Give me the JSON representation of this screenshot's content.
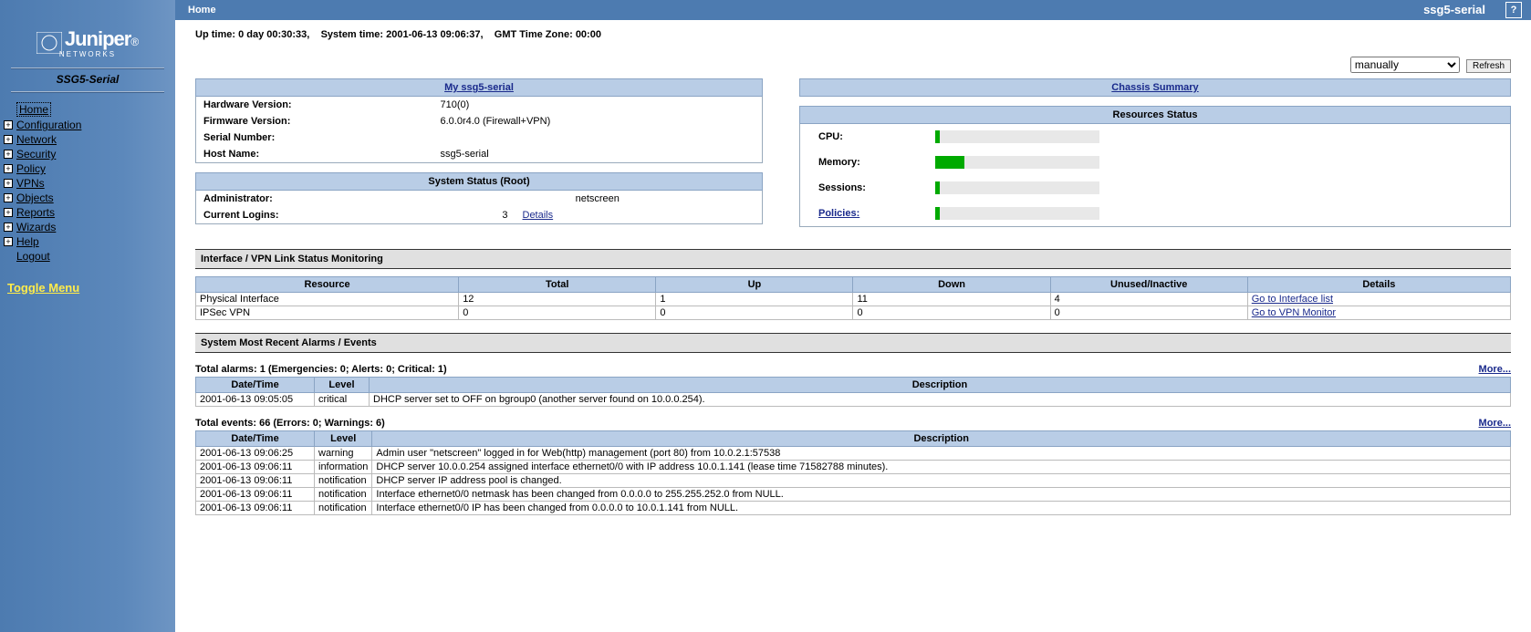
{
  "topbar": {
    "title": "Home",
    "device": "ssg5-serial",
    "help": "?"
  },
  "sidebar": {
    "device_model": "SSG5-Serial",
    "brand_top": "Juniper",
    "brand_sub": "NETWORKS",
    "items": [
      {
        "label": "Home",
        "expandable": false,
        "current": true
      },
      {
        "label": "Configuration",
        "expandable": true
      },
      {
        "label": "Network",
        "expandable": true
      },
      {
        "label": "Security",
        "expandable": true
      },
      {
        "label": "Policy",
        "expandable": true
      },
      {
        "label": "VPNs",
        "expandable": true
      },
      {
        "label": "Objects",
        "expandable": true
      },
      {
        "label": "Reports",
        "expandable": true
      },
      {
        "label": "Wizards",
        "expandable": true
      },
      {
        "label": "Help",
        "expandable": true
      },
      {
        "label": "Logout",
        "expandable": false
      }
    ],
    "toggle": "Toggle Menu"
  },
  "status_line": {
    "uptime_label": "Up time:",
    "uptime_value": "0 day 00:30:33,",
    "systime_label": "System time:",
    "systime_value": "2001-06-13 09:06:37,",
    "tz_label": "GMT Time Zone:",
    "tz_value": "00:00"
  },
  "refresh": {
    "mode": "manually",
    "button": "Refresh"
  },
  "device_panel": {
    "title": "My ssg5-serial",
    "rows": [
      {
        "label": "Hardware Version:",
        "value": "710(0)"
      },
      {
        "label": "Firmware Version:",
        "value": "6.0.0r4.0 (Firewall+VPN)"
      },
      {
        "label": "Serial Number:",
        "value": ""
      },
      {
        "label": "Host Name:",
        "value": "ssg5-serial"
      }
    ]
  },
  "system_status": {
    "title": "System Status  (Root)",
    "admin_label": "Administrator:",
    "admin_value": "netscreen",
    "logins_label": "Current Logins:",
    "logins_value": "3",
    "details": "Details"
  },
  "chassis": {
    "title": "Chassis Summary"
  },
  "resources": {
    "title": "Resources Status",
    "items": [
      {
        "label": "CPU:",
        "pct": 3,
        "link": false
      },
      {
        "label": "Memory:",
        "pct": 18,
        "link": false
      },
      {
        "label": "Sessions:",
        "pct": 3,
        "link": false
      },
      {
        "label": "Policies:",
        "pct": 3,
        "link": true
      }
    ]
  },
  "ifmon": {
    "title": "Interface / VPN Link Status Monitoring",
    "headers": [
      "Resource",
      "Total",
      "Up",
      "Down",
      "Unused/Inactive",
      "Details"
    ],
    "rows": [
      {
        "res": "Physical Interface",
        "total": "12",
        "up": "1",
        "down": "11",
        "inactive": "4",
        "detail": "Go to Interface list"
      },
      {
        "res": "IPSec VPN",
        "total": "0",
        "up": "0",
        "down": "0",
        "inactive": "0",
        "detail": "Go to VPN Monitor"
      }
    ]
  },
  "alarms_section": {
    "title": "System Most Recent Alarms   /   Events",
    "alarm_summary": "Total alarms: 1   (Emergencies: 0; Alerts: 0; Critical: 1)",
    "more": "More...",
    "headers": [
      "Date/Time",
      "Level",
      "Description"
    ],
    "alarms": [
      {
        "dt": "2001-06-13 09:05:05",
        "lvl": "critical",
        "desc": "DHCP server set to OFF on bgroup0 (another server found on 10.0.0.254)."
      }
    ],
    "event_summary": "Total events: 66   (Errors: 0; Warnings: 6)",
    "events": [
      {
        "dt": "2001-06-13 09:06:25",
        "lvl": "warning",
        "desc": "Admin user \"netscreen\" logged in for Web(http) management (port 80) from 10.0.2.1:57538"
      },
      {
        "dt": "2001-06-13 09:06:11",
        "lvl": "information",
        "desc": "DHCP server 10.0.0.254 assigned interface ethernet0/0 with IP address 10.0.1.141 (lease time 71582788 minutes)."
      },
      {
        "dt": "2001-06-13 09:06:11",
        "lvl": "notification",
        "desc": "DHCP server IP address pool is changed."
      },
      {
        "dt": "2001-06-13 09:06:11",
        "lvl": "notification",
        "desc": "Interface ethernet0/0 netmask has been changed from 0.0.0.0 to 255.255.252.0 from NULL."
      },
      {
        "dt": "2001-06-13 09:06:11",
        "lvl": "notification",
        "desc": "Interface ethernet0/0 IP has been changed from 0.0.0.0 to 10.0.1.141 from NULL."
      }
    ]
  }
}
